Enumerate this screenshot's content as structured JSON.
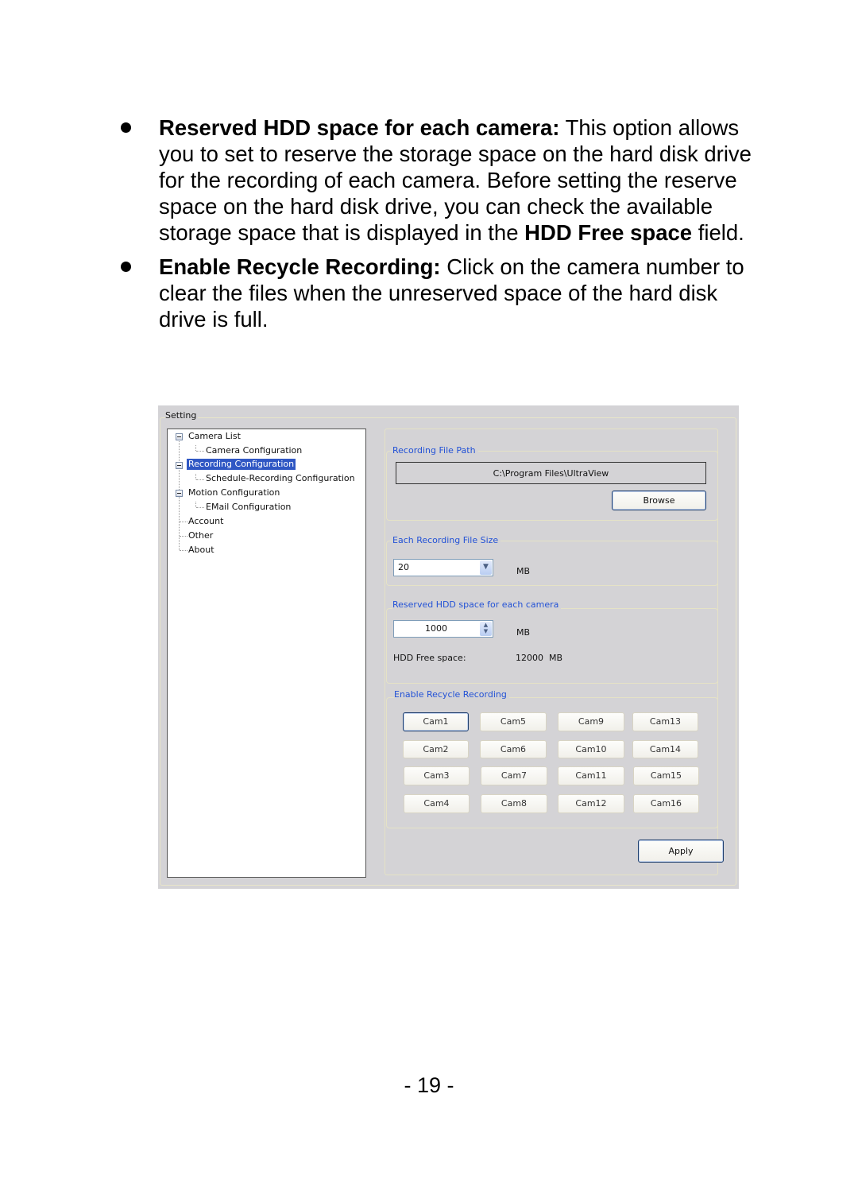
{
  "document": {
    "bullets": [
      {
        "bold": "Reserved HDD space for each camera:",
        "text_1": " This option allows you to set to reserve the storage space on the hard disk drive for the recording of each camera. Before setting the reserve space on the hard disk drive, you can check the available storage space that is displayed in the ",
        "bold_2": "HDD Free space",
        "text_2": " field."
      },
      {
        "bold": "Enable Recycle Recording:",
        "text_1": " Click on the camera number to clear the files when the unreserved space of the hard disk drive is full."
      }
    ],
    "page_number": "- 19 -"
  },
  "app": {
    "title": "Setting",
    "tree": [
      {
        "label": "Camera List",
        "level": 0,
        "expandable": true
      },
      {
        "label": "Camera Configuration",
        "level": 1
      },
      {
        "label": "Recording Configuration",
        "level": 0,
        "expandable": true,
        "selected": true
      },
      {
        "label": "Schedule-Recording Configuration",
        "level": 1
      },
      {
        "label": "Motion Configuration",
        "level": 0,
        "expandable": true
      },
      {
        "label": "EMail Configuration",
        "level": 1
      },
      {
        "label": "Account",
        "level": 0
      },
      {
        "label": "Other",
        "level": 0
      },
      {
        "label": "About",
        "level": 0
      }
    ],
    "recording_file_path": {
      "title": "Recording File Path",
      "value": "C:\\Program Files\\UltraView",
      "browse_label": "Browse"
    },
    "file_size": {
      "title": "Each Recording File Size",
      "value": "20",
      "unit": "MB"
    },
    "reserved_hdd": {
      "title": "Reserved HDD space for each camera",
      "value": "1000",
      "unit": "MB",
      "free_label": "HDD Free space:",
      "free_value": "12000  MB"
    },
    "recycle": {
      "title": "Enable Recycle Recording",
      "cameras": [
        "Cam1",
        "Cam2",
        "Cam3",
        "Cam4",
        "Cam5",
        "Cam6",
        "Cam7",
        "Cam8",
        "Cam9",
        "Cam10",
        "Cam11",
        "Cam12",
        "Cam13",
        "Cam14",
        "Cam15",
        "Cam16"
      ]
    },
    "apply_label": "Apply",
    "colors": {
      "selection": "#2f57c4",
      "group_title": "#2352d6",
      "panel_bg": "#d4d3d6"
    }
  }
}
